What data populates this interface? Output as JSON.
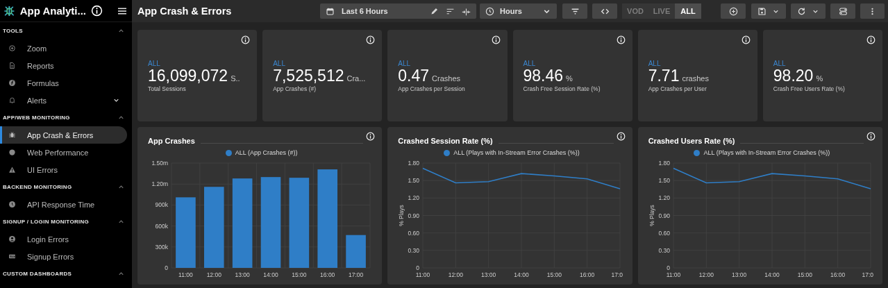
{
  "app": {
    "title": "App Analyti..."
  },
  "sidebar": {
    "sections": [
      {
        "title": "TOOLS",
        "expanded": true,
        "items": [
          {
            "label": "Zoom",
            "selected": false,
            "has_submenu": false
          },
          {
            "label": "Reports",
            "selected": false,
            "has_submenu": false
          },
          {
            "label": "Formulas",
            "selected": false,
            "has_submenu": false
          },
          {
            "label": "Alerts",
            "selected": false,
            "has_submenu": true
          }
        ]
      },
      {
        "title": "APP/WEB MONITORING",
        "expanded": true,
        "items": [
          {
            "label": "App Crash & Errors",
            "selected": true,
            "has_submenu": false
          },
          {
            "label": "Web Performance",
            "selected": false,
            "has_submenu": false
          },
          {
            "label": "UI Errors",
            "selected": false,
            "has_submenu": false
          }
        ]
      },
      {
        "title": "BACKEND MONITORING",
        "expanded": true,
        "items": [
          {
            "label": "API Response Time",
            "selected": false,
            "has_submenu": false
          }
        ]
      },
      {
        "title": "SIGNUP / LOGIN MONITORING",
        "expanded": true,
        "items": [
          {
            "label": "Login Errors",
            "selected": false,
            "has_submenu": false
          },
          {
            "label": "Signup Errors",
            "selected": false,
            "has_submenu": false
          }
        ]
      },
      {
        "title": "CUSTOM DASHBOARDS",
        "expanded": true
      }
    ]
  },
  "toolbar": {
    "title": "App Crash & Errors",
    "date_range": "Last 6 Hours",
    "granularity": "Hours",
    "modes": [
      {
        "label": "VOD",
        "selected": false
      },
      {
        "label": "LIVE",
        "selected": false
      },
      {
        "label": "ALL",
        "selected": true
      }
    ]
  },
  "kpis": [
    {
      "segment": "ALL",
      "value": "16,099,072",
      "unit": "S..",
      "caption": "Total Sessions"
    },
    {
      "segment": "ALL",
      "value": "7,525,512",
      "unit": "Cra...",
      "caption": "App Crashes (#)"
    },
    {
      "segment": "ALL",
      "value": "0.47",
      "unit": "Crashes",
      "caption": "App Crashes per Session"
    },
    {
      "segment": "ALL",
      "value": "98.46",
      "unit": "%",
      "caption": "Crash Free Session Rate (%)"
    },
    {
      "segment": "ALL",
      "value": "7.71",
      "unit": "crashes",
      "caption": "App Crashes per User"
    },
    {
      "segment": "ALL",
      "value": "98.20",
      "unit": "%",
      "caption": "Crash Free Users Rate (%)"
    }
  ],
  "charts": [
    {
      "chart_data": {
        "type": "bar",
        "title": "App Crashes",
        "grid": true,
        "categories": [
          "11:00",
          "12:00",
          "13:00",
          "14:00",
          "15:00",
          "16:00",
          "17:00"
        ],
        "series": [
          {
            "name": "ALL (App Crashes (#))",
            "color": "#2f7ec7",
            "values": [
              1010000,
              1160000,
              1280000,
              1300000,
              1290000,
              1410000,
              470000
            ]
          }
        ],
        "ylim": [
          0,
          1500000
        ],
        "yticks": [
          {
            "value": 0,
            "label": "0"
          },
          {
            "value": 300000,
            "label": "300k"
          },
          {
            "value": 600000,
            "label": "600k"
          },
          {
            "value": 900000,
            "label": "900k"
          },
          {
            "value": 1200000,
            "label": "1.20m"
          },
          {
            "value": 1500000,
            "label": "1.50m"
          }
        ]
      }
    },
    {
      "chart_data": {
        "type": "line",
        "title": "Crashed Session Rate (%)",
        "grid": true,
        "ylabel": "% Plays",
        "categories": [
          "11:00",
          "12:00",
          "13:00",
          "14:00",
          "15:00",
          "16:00",
          "17:0"
        ],
        "series": [
          {
            "name": "ALL (Plays with In-Stream Error Crashes (%))",
            "color": "#2f7ec7",
            "values": [
              1.71,
              1.46,
              1.48,
              1.62,
              1.58,
              1.53,
              1.36
            ]
          }
        ],
        "ylim": [
          0,
          1.8
        ],
        "yticks": [
          {
            "value": 0,
            "label": "0"
          },
          {
            "value": 0.3,
            "label": "0.30"
          },
          {
            "value": 0.6,
            "label": "0.60"
          },
          {
            "value": 0.9,
            "label": "0.90"
          },
          {
            "value": 1.2,
            "label": "1.20"
          },
          {
            "value": 1.5,
            "label": "1.50"
          },
          {
            "value": 1.8,
            "label": "1.80"
          }
        ]
      }
    },
    {
      "chart_data": {
        "type": "line",
        "title": "Crashed Users Rate (%)",
        "grid": true,
        "ylabel": "% Plays",
        "categories": [
          "11:00",
          "12:00",
          "13:00",
          "14:00",
          "15:00",
          "16:00",
          "17:0"
        ],
        "series": [
          {
            "name": "ALL (Plays with In-Stream Error Crashes (%))",
            "color": "#2f7ec7",
            "values": [
              1.71,
              1.46,
              1.48,
              1.62,
              1.58,
              1.53,
              1.36
            ]
          }
        ],
        "ylim": [
          0,
          1.8
        ],
        "yticks": [
          {
            "value": 0,
            "label": "0"
          },
          {
            "value": 0.3,
            "label": "0.30"
          },
          {
            "value": 0.6,
            "label": "0.60"
          },
          {
            "value": 0.9,
            "label": "0.90"
          },
          {
            "value": 1.2,
            "label": "1.20"
          },
          {
            "value": 1.5,
            "label": "1.50"
          },
          {
            "value": 1.8,
            "label": "1.80"
          }
        ]
      }
    }
  ]
}
